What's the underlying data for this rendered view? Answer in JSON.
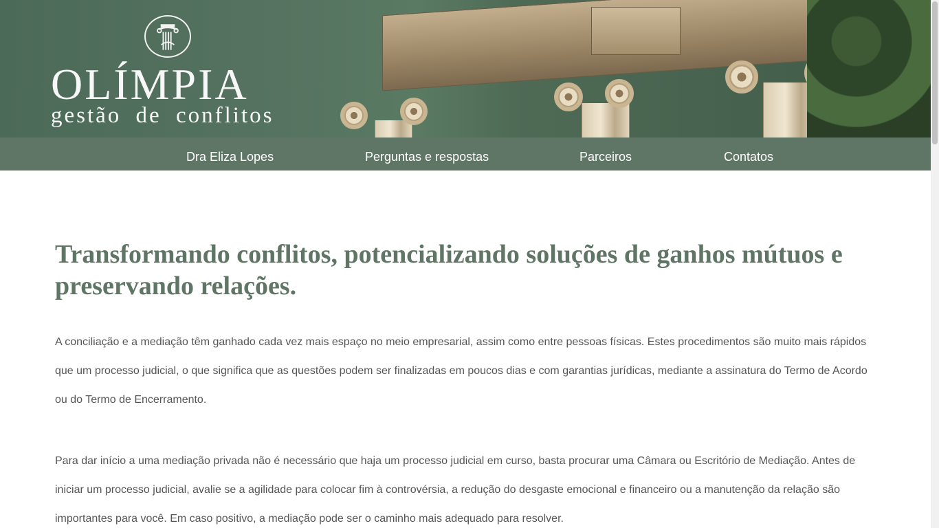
{
  "header": {
    "logo_title": "OLÍMPIA",
    "logo_subtitle": "gestão de conflitos",
    "emblem_icon": "column-capital-icon"
  },
  "nav": {
    "items": [
      {
        "label": "Dra Eliza Lopes"
      },
      {
        "label": "Perguntas e respostas"
      },
      {
        "label": "Parceiros"
      },
      {
        "label": "Contatos"
      }
    ]
  },
  "main": {
    "headline": "Transformando conflitos, potencializando soluções de ganhos mútuos e preservando relações.",
    "paragraphs": [
      "A conciliação e a mediação têm ganhado cada vez mais espaço no meio empresarial, assim como entre pessoas físicas. Estes procedimentos são muito mais rápidos que um processo judicial, o que significa que as questões podem ser finalizadas em poucos dias e com garantias jurídicas, mediante a assinatura do Termo de Acordo ou do Termo de Encerramento.",
      "Para dar início a uma mediação privada não é necessário que haja um processo judicial em curso, basta procurar uma Câmara ou Escritório de Mediação. Antes de iniciar um processo judicial, avalie se a agilidade para colocar fim à controvérsia, a redução do desgaste emocional e financeiro ou a manutenção da relação são importantes para você. Em caso positivo, a mediação pode ser o caminho mais adequado para resolver."
    ]
  },
  "colors": {
    "brand_green": "#5f7565",
    "body_text": "#555555"
  }
}
